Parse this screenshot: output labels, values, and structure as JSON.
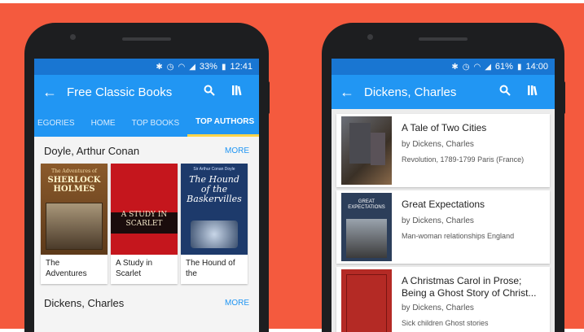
{
  "left": {
    "status": {
      "battery": "33%",
      "time": "12:41"
    },
    "appbar": {
      "title": "Free Classic Books"
    },
    "tabs": [
      "EGORIES",
      "HOME",
      "TOP BOOKS",
      "TOP AUTHORS"
    ],
    "sections": [
      {
        "author": "Doyle, Arthur Conan",
        "more": "MORE",
        "books": [
          {
            "title": "The Adventures",
            "cover_text": "SHERLOCK HOLMES",
            "cover_sub": "The Adventures of"
          },
          {
            "title": "A Study in Scarlet",
            "cover_text": "A STUDY IN SCARLET",
            "cover_sub": ""
          },
          {
            "title": "The Hound of the",
            "cover_text": "The Hound of the Baskervilles",
            "cover_sub": "Sir Arthur Conan Doyle"
          }
        ]
      },
      {
        "author": "Dickens, Charles",
        "more": "MORE"
      }
    ]
  },
  "right": {
    "status": {
      "battery": "61%",
      "time": "14:00"
    },
    "appbar": {
      "title": "Dickens, Charles"
    },
    "items": [
      {
        "title": "A Tale of Two Cities",
        "author": "by Dickens, Charles",
        "subject": "Revolution, 1789-1799 Paris (France)"
      },
      {
        "title": "Great Expectations",
        "author": "by Dickens, Charles",
        "subject": "Man-woman relationships England",
        "cover_text": "GREAT EXPECTATIONS"
      },
      {
        "title": "A Christmas Carol in Prose; Being a Ghost Story of Christ...",
        "author": "by Dickens, Charles",
        "subject": "Sick children Ghost stories"
      }
    ]
  }
}
